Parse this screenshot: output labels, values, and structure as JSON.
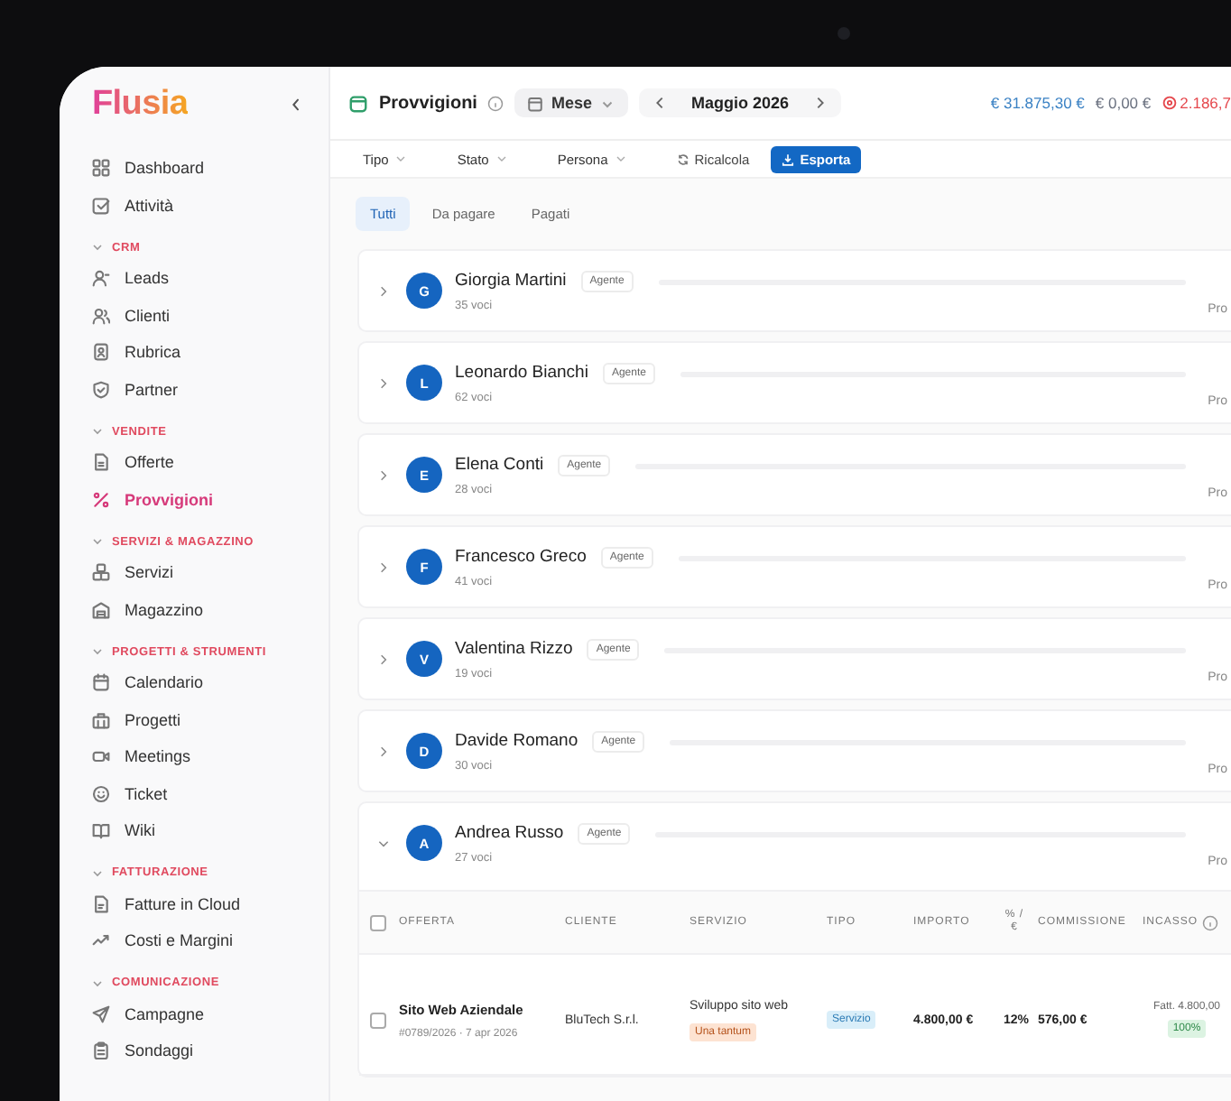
{
  "sidebar": {
    "logo": "Flusia",
    "items": [
      {
        "label": "Dashboard",
        "selected": false
      },
      {
        "label": "Attività",
        "selected": false
      }
    ],
    "sections": [
      {
        "label": "CRM",
        "expanded": true,
        "items": [
          {
            "label": "Leads",
            "selected": false
          },
          {
            "label": "Clienti",
            "selected": false
          },
          {
            "label": "Rubrica",
            "selected": false
          },
          {
            "label": "Partner",
            "selected": false
          }
        ]
      },
      {
        "label": "VENDITE",
        "expanded": true,
        "items": [
          {
            "label": "Offerte",
            "selected": false
          },
          {
            "label": "Provvigioni",
            "selected": true
          }
        ]
      },
      {
        "label": "SERVIZI & MAGAZZINO",
        "expanded": true,
        "items": [
          {
            "label": "Servizi",
            "selected": false
          },
          {
            "label": "Magazzino",
            "selected": false
          }
        ]
      },
      {
        "label": "PROGETTI & STRUMENTI",
        "expanded": true,
        "items": [
          {
            "label": "Calendario",
            "selected": false
          },
          {
            "label": "Progetti",
            "selected": false
          },
          {
            "label": "Meetings",
            "selected": false
          },
          {
            "label": "Ticket",
            "selected": false
          },
          {
            "label": "Wiki",
            "selected": false
          }
        ]
      },
      {
        "label": "FATTURAZIONE",
        "expanded": true,
        "items": [
          {
            "label": "Fatture in Cloud",
            "selected": false
          },
          {
            "label": "Costi e Margini",
            "selected": false
          }
        ]
      },
      {
        "label": "COMUNICAZIONE",
        "expanded": true,
        "items": [
          {
            "label": "Campagne",
            "selected": false
          },
          {
            "label": "Sondaggi",
            "selected": false
          }
        ]
      }
    ]
  },
  "header": {
    "title": "Provvigioni",
    "period": "Mese",
    "month": "Maggio 2026",
    "totals": [
      {
        "kind": "plain",
        "value": "€ 31.875,30 €",
        "color": "#3b82c4"
      },
      {
        "kind": "plain",
        "value": "€ 0,00 €",
        "color": "#6b7280"
      },
      {
        "kind": "alert",
        "value": "2.186,7",
        "color": "#e5484d"
      }
    ]
  },
  "filters": [
    {
      "kind": "dropdown",
      "label": "Tipo"
    },
    {
      "kind": "dropdown",
      "label": "Stato"
    },
    {
      "kind": "dropdown",
      "label": "Persona"
    },
    {
      "kind": "action",
      "label": "Ricalcola"
    },
    {
      "kind": "primary",
      "label": "Esporta"
    }
  ],
  "tabs": [
    {
      "label": "Tutti",
      "selected": true
    },
    {
      "label": "Da pagare",
      "selected": false
    },
    {
      "label": "Pagati",
      "selected": false
    }
  ],
  "groups": [
    {
      "initial": "G",
      "name": "Giorgia Martini",
      "role": "Agente",
      "count": "35 voci",
      "trailing": "Pro",
      "expanded": false
    },
    {
      "initial": "L",
      "name": "Leonardo Bianchi",
      "role": "Agente",
      "count": "62 voci",
      "trailing": "Pro",
      "expanded": false
    },
    {
      "initial": "E",
      "name": "Elena Conti",
      "role": "Agente",
      "count": "28 voci",
      "trailing": "Pro",
      "expanded": false
    },
    {
      "initial": "F",
      "name": "Francesco Greco",
      "role": "Agente",
      "count": "41 voci",
      "trailing": "Pro",
      "expanded": false
    },
    {
      "initial": "V",
      "name": "Valentina Rizzo",
      "role": "Agente",
      "count": "19 voci",
      "trailing": "Pro",
      "expanded": false
    },
    {
      "initial": "D",
      "name": "Davide Romano",
      "role": "Agente",
      "count": "30 voci",
      "trailing": "Pro",
      "expanded": false
    },
    {
      "initial": "A",
      "name": "Andrea Russo",
      "role": "Agente",
      "count": "27 voci",
      "trailing": "Pro",
      "expanded": true
    }
  ],
  "table": {
    "all_checked": false,
    "columns": [
      "OFFERTA",
      "CLIENTE",
      "SERVIZIO",
      "TIPO",
      "IMPORTO",
      "% / €",
      "COMMISSIONE",
      "INCASSO"
    ],
    "rows": [
      {
        "checked": false,
        "offerta": "Sito Web Aziendale",
        "ref": "#0789/2026 · 7 apr 2026",
        "cliente": "BluTech S.r.l.",
        "servizio": "Sviluppo sito web",
        "frequenza": "Una tantum",
        "tipo": "Servizio",
        "importo": "4.800,00 €",
        "percentuale": "12%",
        "commissione": "576,00 €",
        "incasso": "Fatt. 4.800,00",
        "incasso_pct": "100%"
      }
    ]
  }
}
